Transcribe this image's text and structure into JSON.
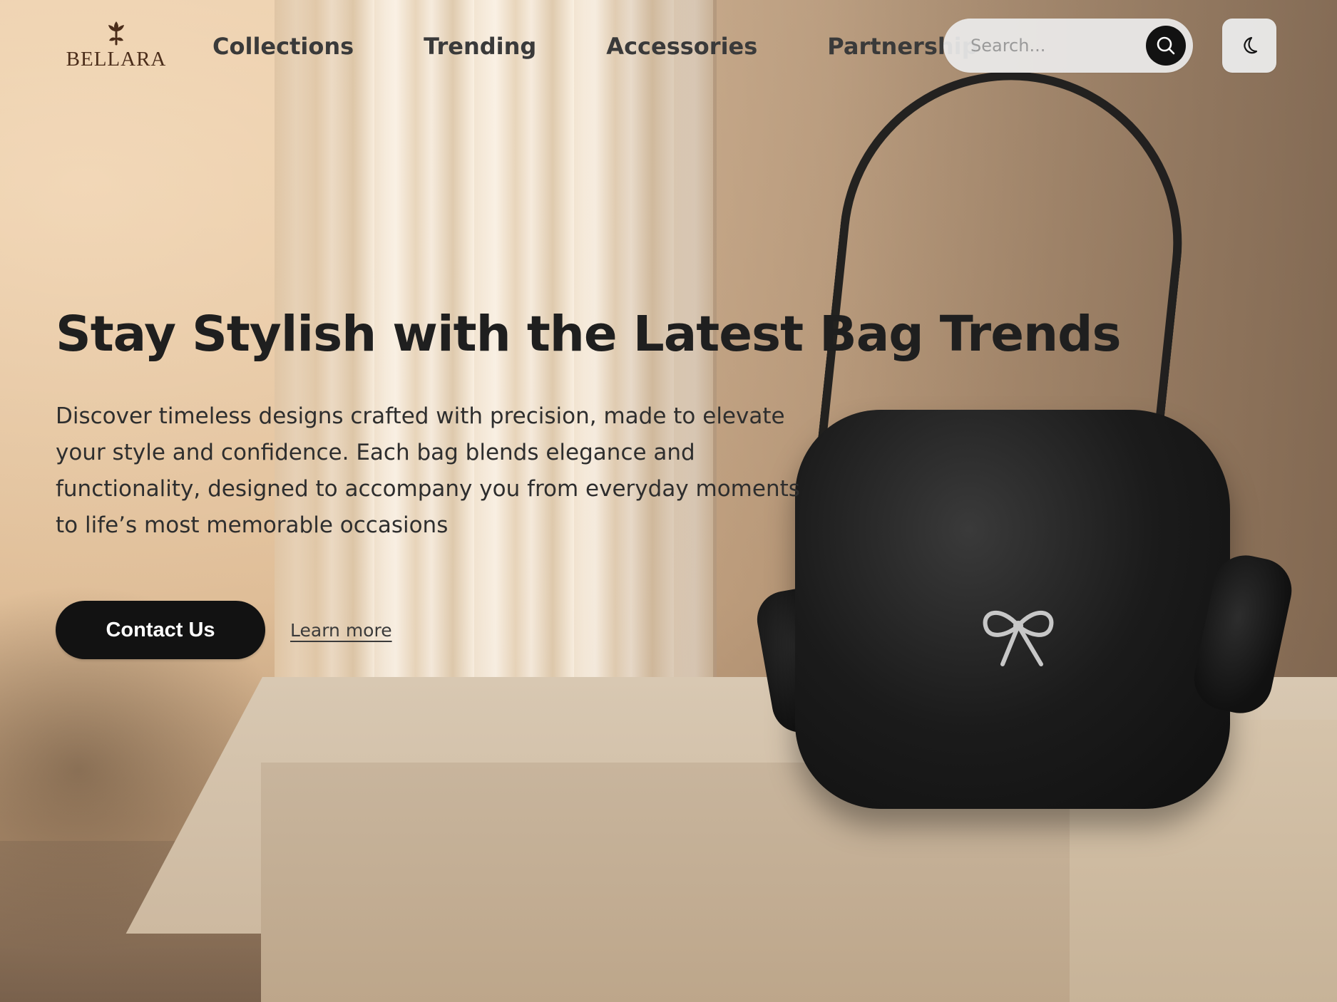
{
  "brand": {
    "name": "BELLARA",
    "logo_color": "#4b2d1a"
  },
  "nav": {
    "items": [
      {
        "label": "Collections"
      },
      {
        "label": "Trending"
      },
      {
        "label": "Accessories"
      },
      {
        "label": "Partnership"
      }
    ]
  },
  "search": {
    "placeholder": "Search...",
    "value": "",
    "button_icon": "search-icon"
  },
  "theme_toggle": {
    "icon": "moon-icon"
  },
  "hero": {
    "title": "Stay Stylish with the Latest Bag Trends",
    "description": "Discover timeless designs crafted with precision, made to elevate your style and confidence. Each bag blends elegance and functionality, designed to accompany you from everyday moments to life’s most memorable occasions",
    "primary_cta": "Contact Us",
    "secondary_cta": "Learn more"
  },
  "colors": {
    "primary_button_bg": "#121212",
    "primary_button_text": "#ffffff",
    "text": "#232323",
    "search_bg": "#ebebeb"
  },
  "images": {
    "hero_background": "handbag-on-pedestal-photo"
  }
}
